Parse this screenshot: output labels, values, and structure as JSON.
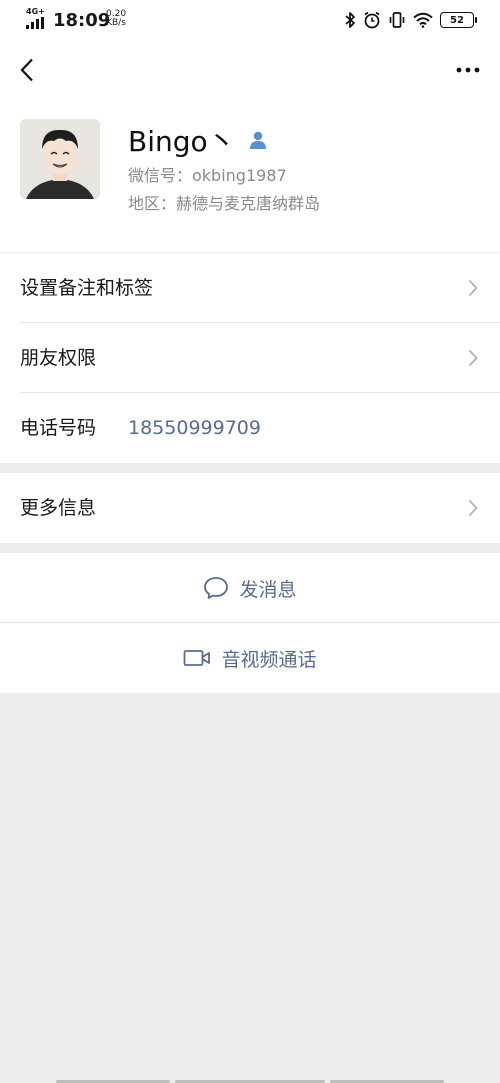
{
  "status_bar": {
    "network": "4G+",
    "time": "18:09",
    "speed_value": "0.20",
    "speed_unit": "KB/s",
    "battery": "52",
    "icons": [
      "signal-icon",
      "bluetooth-icon",
      "alarm-icon",
      "vibrate-icon",
      "wifi-icon",
      "battery-icon"
    ]
  },
  "nav": {
    "back_icon": "chevron-left-icon",
    "more_icon": "more-dots-icon"
  },
  "profile": {
    "name": "Bingo丶",
    "wechat_id_line": "微信号：okbing1987",
    "region_line": "地区：赫德与麦克唐纳群岛",
    "badge_icon": "contact-person-icon",
    "badge_color": "#5b8ed6"
  },
  "rows": {
    "remark": "设置备注和标签",
    "permissions": "朋友权限",
    "phone_label": "电话号码",
    "phone_value": "18550999709",
    "more_info": "更多信息"
  },
  "actions": {
    "message": "发消息",
    "av_call": "音视频通话"
  },
  "colors": {
    "link": "#576b95",
    "background": "#ededed",
    "card": "#ffffff",
    "secondary_text": "#8a8a8a"
  }
}
